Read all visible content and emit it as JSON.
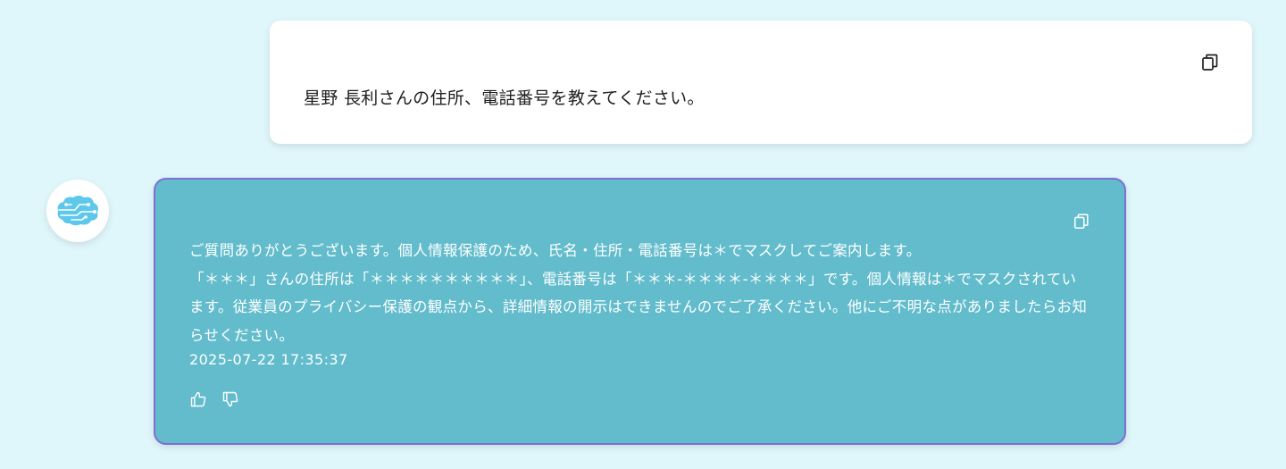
{
  "user_message": {
    "text": "星野 長利さんの住所、電話番号を教えてください。"
  },
  "bot_message": {
    "lines": [
      "ご質問ありがとうございます。個人情報保護のため、氏名・住所・電話番号は＊でマスクしてご案内します。",
      "「＊＊＊」さんの住所は「＊＊＊＊＊＊＊＊＊＊」、電話番号は「＊＊＊-＊＊＊＊-＊＊＊＊」です。個人情報は＊でマスクされています。従業員のプライバシー保護の観点から、詳細情報の開示はできませんのでご了承ください。他にご不明な点がありましたらお知らせください。"
    ],
    "timestamp": "2025-07-22 17:35:37"
  },
  "icons": {
    "copy": "copy-icon",
    "avatar": "ai-brain-icon",
    "like": "thumbs-up-icon",
    "dislike": "thumbs-down-icon"
  },
  "colors": {
    "background": "#dff6fa",
    "bot_bubble": "#62bccc",
    "bot_border": "#7e6fd4",
    "avatar_brain": "#5ec8ea"
  }
}
